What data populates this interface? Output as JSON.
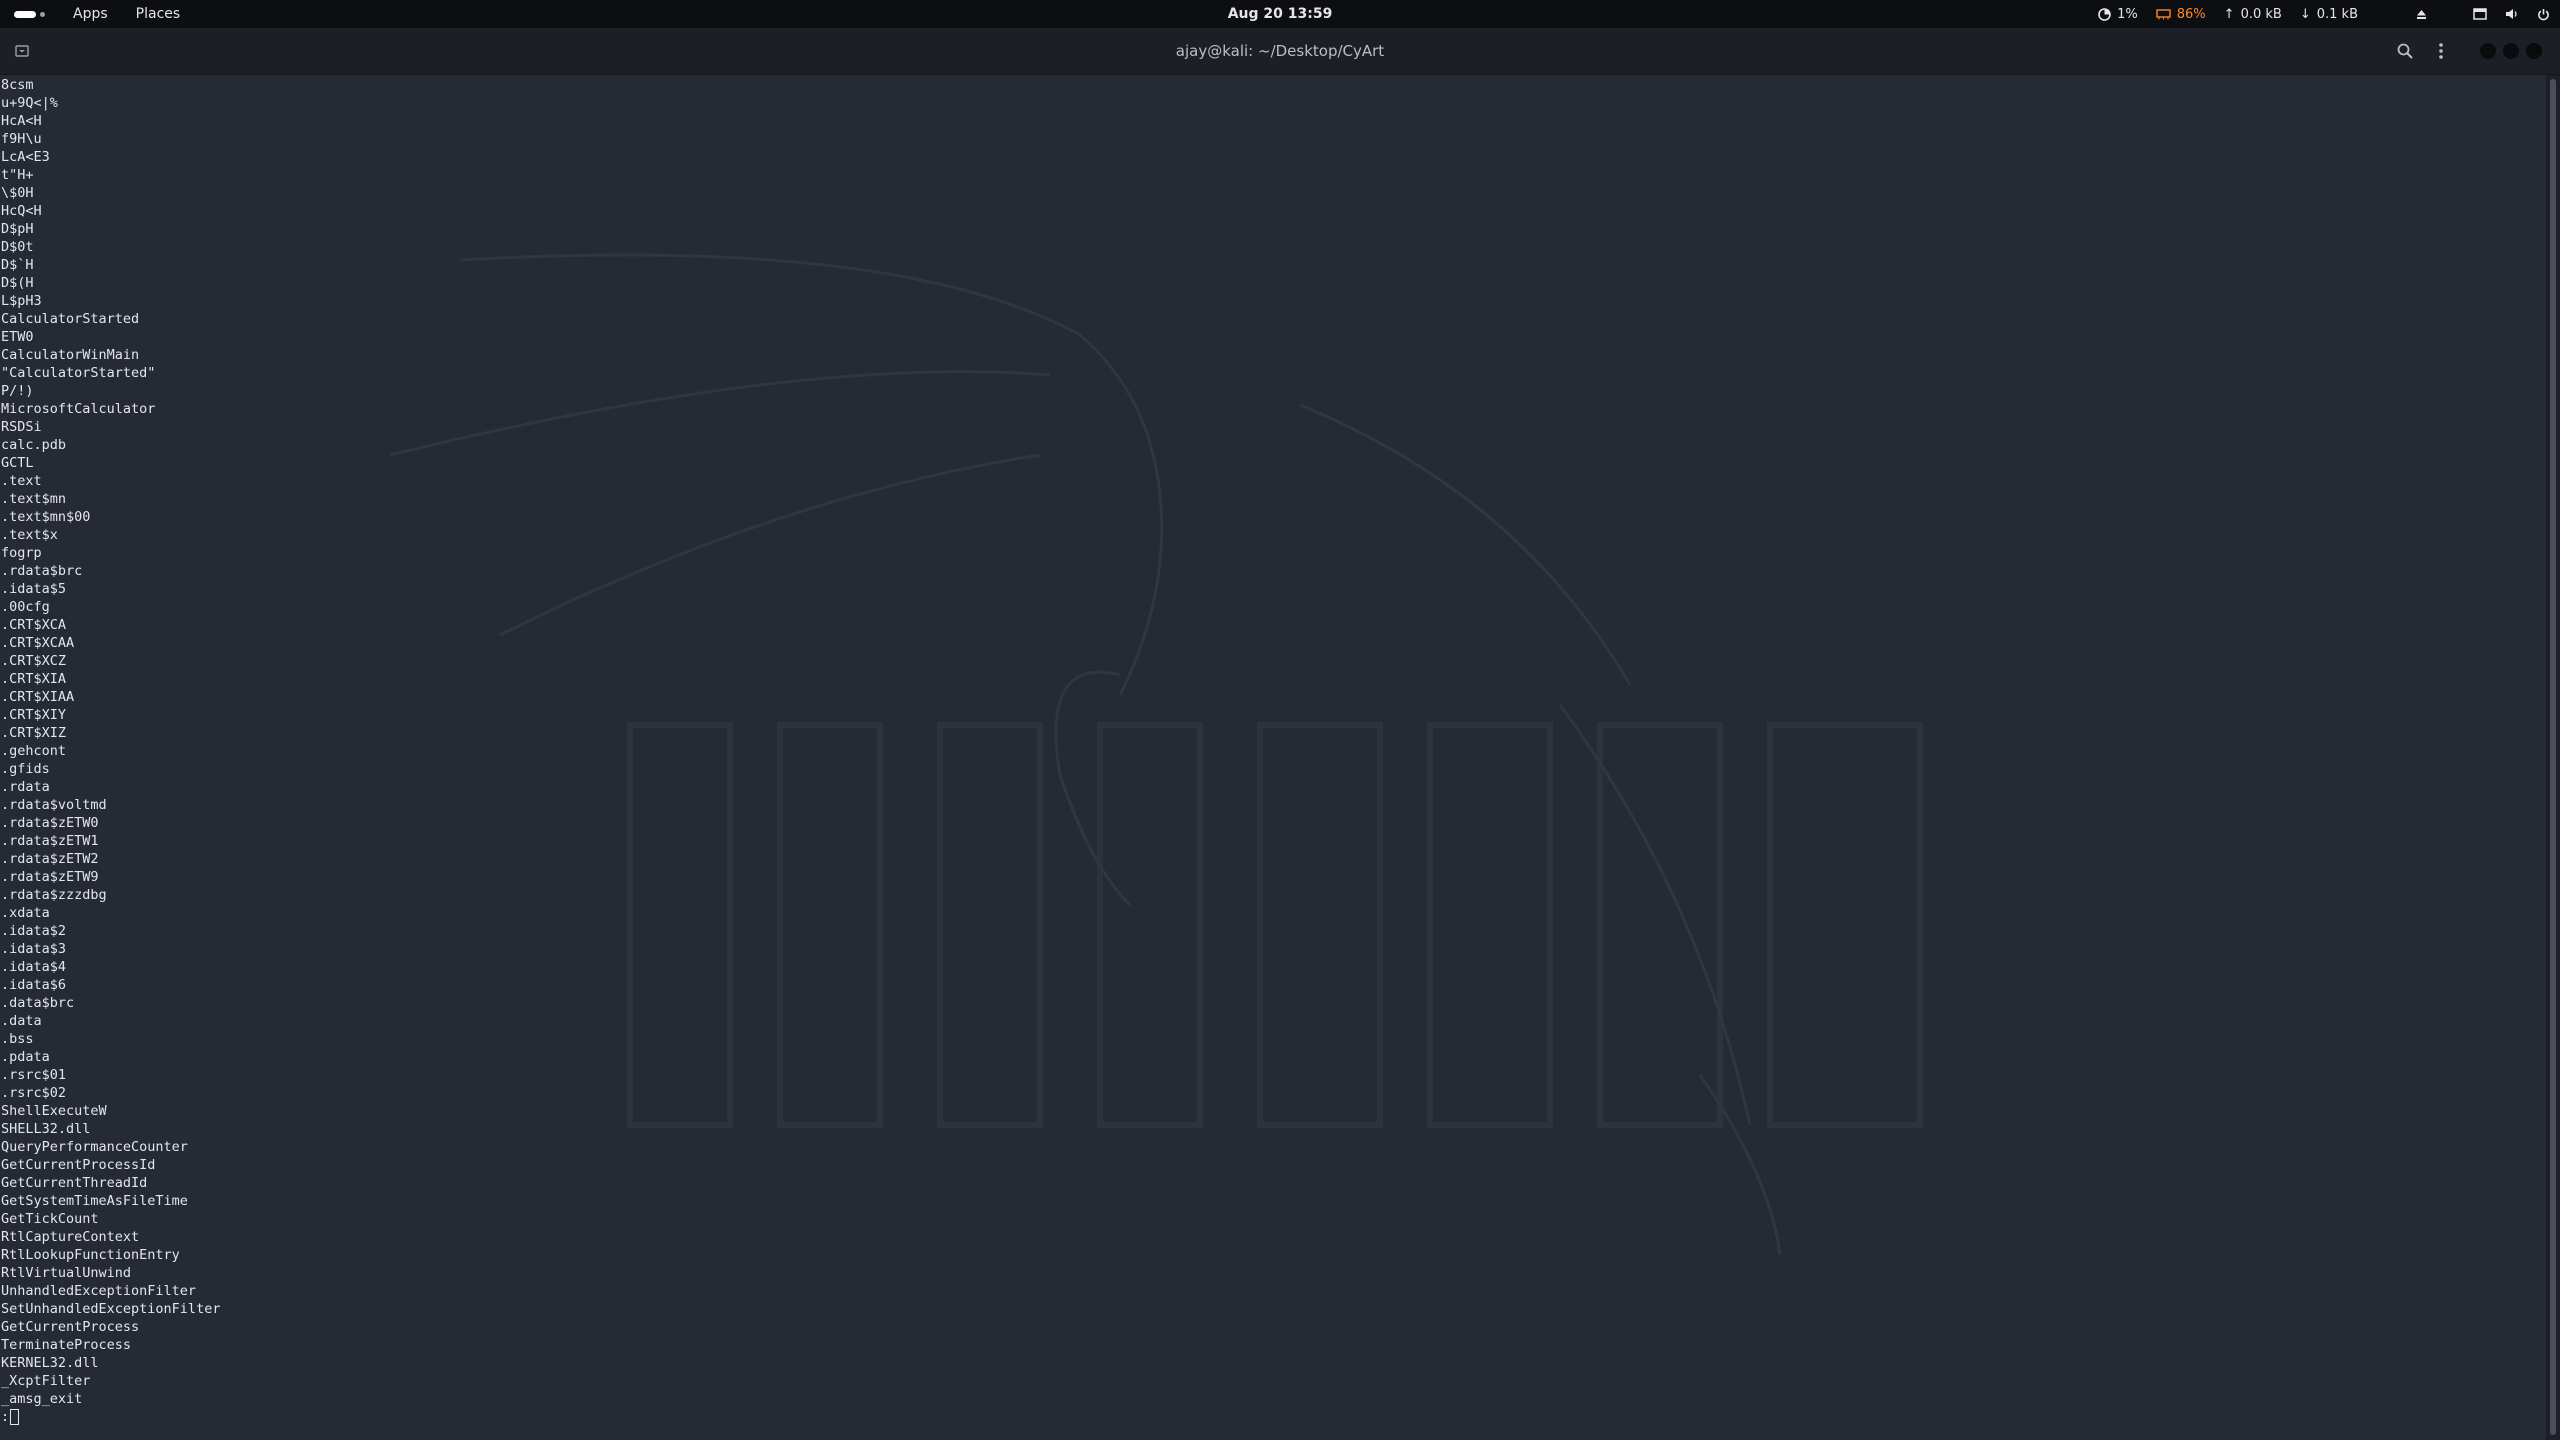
{
  "topbar": {
    "apps_label": "Apps",
    "places_label": "Places",
    "clock": "Aug 20  13:59",
    "cpu": "1%",
    "memory": "86%",
    "upload": "0.0 kB",
    "download": "0.1 kB"
  },
  "terminal": {
    "title": "ajay@kali: ~/Desktop/CyArt",
    "lines": [
      "8csm",
      "u+9Q<|%",
      "HcA<H",
      "f9H\\u",
      "LcA<E3",
      "t\"H+",
      "\\$0H",
      "HcQ<H",
      "D$pH",
      "D$0t",
      "D$`H",
      "D$(H",
      "L$pH3",
      "CalculatorStarted",
      "ETW0",
      "CalculatorWinMain",
      "\"CalculatorStarted\"",
      "P/!)",
      "MicrosoftCalculator",
      "RSDSi",
      "calc.pdb",
      "GCTL",
      ".text",
      ".text$mn",
      ".text$mn$00",
      ".text$x",
      "fogrp",
      ".rdata$brc",
      ".idata$5",
      ".00cfg",
      ".CRT$XCA",
      ".CRT$XCAA",
      ".CRT$XCZ",
      ".CRT$XIA",
      ".CRT$XIAA",
      ".CRT$XIY",
      ".CRT$XIZ",
      ".gehcont",
      ".gfids",
      ".rdata",
      ".rdata$voltmd",
      ".rdata$zETW0",
      ".rdata$zETW1",
      ".rdata$zETW2",
      ".rdata$zETW9",
      ".rdata$zzzdbg",
      ".xdata",
      ".idata$2",
      ".idata$3",
      ".idata$4",
      ".idata$6",
      ".data$brc",
      ".data",
      ".bss",
      ".pdata",
      ".rsrc$01",
      ".rsrc$02",
      "ShellExecuteW",
      "SHELL32.dll",
      "QueryPerformanceCounter",
      "GetCurrentProcessId",
      "GetCurrentThreadId",
      "GetSystemTimeAsFileTime",
      "GetTickCount",
      "RtlCaptureContext",
      "RtlLookupFunctionEntry",
      "RtlVirtualUnwind",
      "UnhandledExceptionFilter",
      "SetUnhandledExceptionFilter",
      "GetCurrentProcess",
      "TerminateProcess",
      "KERNEL32.dll",
      "_XcptFilter",
      "_amsg_exit"
    ],
    "prompt": ":"
  }
}
